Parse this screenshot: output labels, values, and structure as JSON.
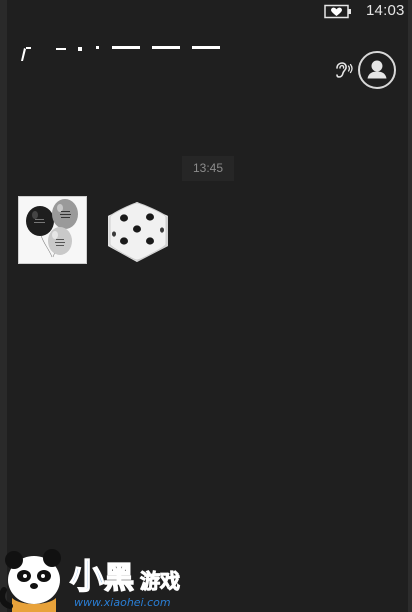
{
  "status_bar": {
    "time": "14:03",
    "battery_icon": "battery-heart-icon"
  },
  "header": {
    "speaker_icon": "speaker-earpiece-icon",
    "avatar_icon": "contact-avatar-icon"
  },
  "conversation": {
    "timestamp": "13:45",
    "messages": [
      {
        "type": "sticker",
        "icon": "balloons-sticker"
      },
      {
        "type": "sticker",
        "icon": "dice-sticker",
        "dice_face": 5
      }
    ]
  },
  "watermark": {
    "brand_text": "小黑游戏",
    "url_text": "www.xiaohei.com"
  },
  "colors": {
    "background": "#1f1f1f",
    "text": "#e6e6e6",
    "timestamp_bg": "#262626",
    "timestamp_text": "#8c8c8c",
    "watermark_blue": "#2a7fd6"
  }
}
